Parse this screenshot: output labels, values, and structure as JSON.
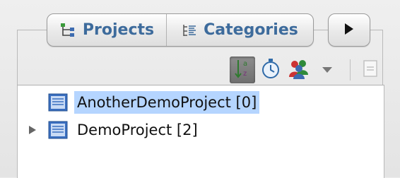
{
  "tabs": [
    {
      "label": "Projects",
      "icon": "project-tree-icon"
    },
    {
      "label": "Categories",
      "icon": "categories-list-icon"
    }
  ],
  "overflow_button_icon": "play-arrow-icon",
  "toolbar": {
    "buttons": [
      {
        "name": "sort-az-button",
        "icon": "sort-az-icon",
        "active": true
      },
      {
        "name": "timer-button",
        "icon": "stopwatch-icon",
        "active": false
      },
      {
        "name": "people-button",
        "icon": "people-icon",
        "active": false
      }
    ],
    "dropdown_icon": "chevron-down-icon",
    "collapse_icon": "collapse-all-icon"
  },
  "tree": {
    "items": [
      {
        "label": "AnotherDemoProject [0]",
        "selected": true,
        "expandable": false
      },
      {
        "label": "DemoProject [2]",
        "selected": false,
        "expandable": true
      }
    ]
  },
  "colors": {
    "tab_text": "#3d6b9c",
    "selection": "#b5d5ff",
    "panel_bg": "#ececec"
  }
}
